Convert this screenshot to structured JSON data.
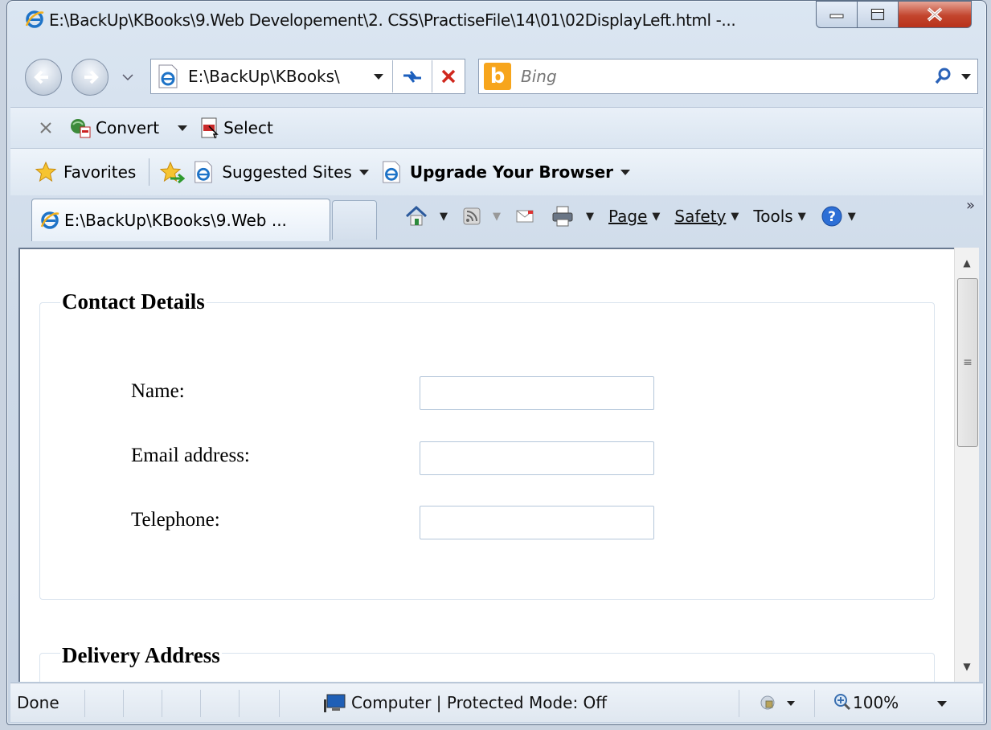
{
  "window": {
    "title": "E:\\BackUp\\KBooks\\9.Web Developement\\2. CSS\\PractiseFile\\14\\01\\02DisplayLeft.html -..."
  },
  "navigation": {
    "address": "E:\\BackUp\\KBooks\\",
    "search_placeholder": "Bing"
  },
  "toolbar": {
    "convert_label": "Convert",
    "select_label": "Select"
  },
  "favorites_bar": {
    "favorites_label": "Favorites",
    "suggested_sites_label": "Suggested Sites",
    "upgrade_label": "Upgrade Your Browser"
  },
  "tabs": [
    {
      "label": "E:\\BackUp\\KBooks\\9.Web ..."
    }
  ],
  "command_bar": {
    "page_label": "Page",
    "safety_label": "Safety",
    "tools_label": "Tools",
    "more_label": "»"
  },
  "page": {
    "contact_legend": "Contact Details",
    "fields": [
      {
        "label": "Name:",
        "value": ""
      },
      {
        "label": "Email address:",
        "value": ""
      },
      {
        "label": "Telephone:",
        "value": ""
      }
    ],
    "delivery_legend": "Delivery Address"
  },
  "status_bar": {
    "status": "Done",
    "zone": "Computer | Protected Mode: Off",
    "zoom": "100%"
  }
}
